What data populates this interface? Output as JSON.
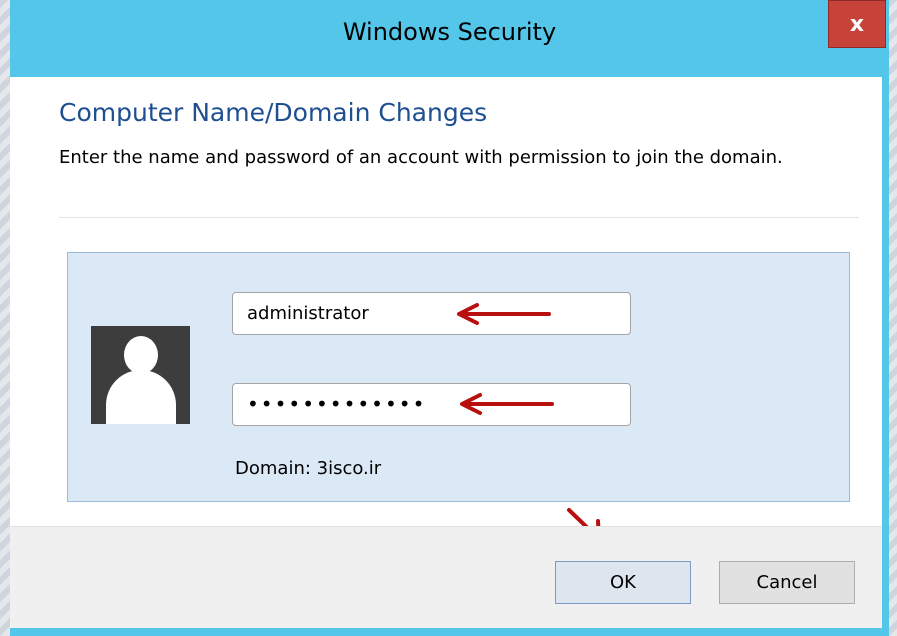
{
  "window": {
    "title": "Windows Security",
    "close_label": "x"
  },
  "dialog": {
    "heading": "Computer Name/Domain Changes",
    "description": "Enter the name and password of an account with permission to join the domain.",
    "username": {
      "value": "administrator"
    },
    "password": {
      "masked_value": "•••••••••••••"
    },
    "domain_label": "Domain: 3isco.ir"
  },
  "buttons": {
    "ok": "OK",
    "cancel": "Cancel"
  },
  "colors": {
    "titlebar": "#54c6e9",
    "close_button": "#c7433a",
    "heading_text": "#1e4f91",
    "credential_panel": "#dbe8f6",
    "annotation_arrow": "#b80f0f"
  },
  "icons": {
    "avatar": "user-silhouette-icon",
    "annotation": "red-arrow-icon"
  }
}
